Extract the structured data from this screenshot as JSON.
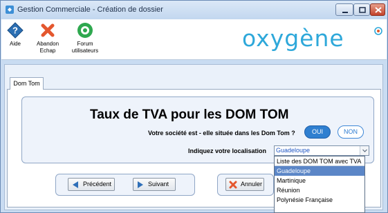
{
  "window": {
    "title": "Gestion Commerciale - Création de dossier"
  },
  "toolbar": {
    "aide_label": "Aide",
    "abandon_label": "Abandon\nEchap",
    "forum_label": "Forum\nutilisateurs"
  },
  "brand": {
    "logo_text": "oxygène",
    "logo_color": "#2ea8da"
  },
  "tab": {
    "label": "Dom Tom"
  },
  "form": {
    "title": "Taux de TVA pour les DOM TOM",
    "question_dom_tom": "Votre société est - elle située dans les Dom Tom ?",
    "oui_label": "OUI",
    "non_label": "NON",
    "localisation_label": "Indiquez votre localisation",
    "localisation_value": "Guadeloupe"
  },
  "dropdown": {
    "header": "Liste des DOM TOM avec TVA",
    "options": [
      "Guadeloupe",
      "Martinique",
      "Réunion",
      "Polynésie Française"
    ],
    "selected": "Guadeloupe"
  },
  "buttons": {
    "previous_label": "Précédent",
    "next_label": "Suivant",
    "cancel_label": "Annuler"
  },
  "colors": {
    "accent": "#2f7fd0",
    "selection": "#5b86c7"
  }
}
